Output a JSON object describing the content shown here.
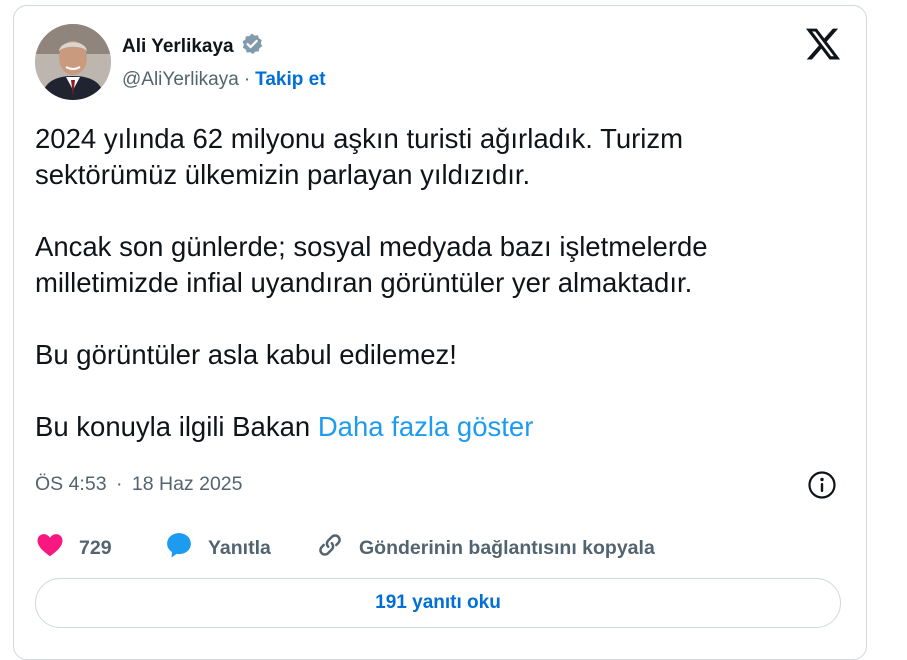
{
  "author": {
    "name": "Ali Yerlikaya",
    "handle": "@AliYerlikaya",
    "separator": "·",
    "follow_label": "Takip et",
    "verified_icon": "verified-badge-icon",
    "avatar": "profile-photo"
  },
  "platform_icon": "x-logo-icon",
  "tweet": {
    "text": "2024 yılında 62 milyonu aşkın turisti ağırladık. Turizm\nsektörümüz ülkemizin parlayan yıldızıdır.\n\nAncak son günlerde; sosyal medyada bazı işletmelerde\nmilletimizde infial uyandıran görüntüler yer almaktadır.\n\nBu görüntüler asla kabul edilemez!\n\nBu konuyla ilgili Bakan ",
    "show_more": "Daha fazla göster"
  },
  "meta": {
    "time": "ÖS 4:53",
    "separator": "·",
    "date": "18 Haz 2025",
    "info_icon": "info-icon"
  },
  "actions": {
    "likes": {
      "icon": "heart-icon",
      "count": "729",
      "color": "#f91880"
    },
    "reply": {
      "icon": "reply-bubble-icon",
      "label": "Yanıtla",
      "color": "#1d9bf0"
    },
    "copy": {
      "icon": "link-icon",
      "label": "Gönderinin bağlantısını kopyala"
    }
  },
  "replies_button": {
    "label": "191 yanıtı oku"
  },
  "colors": {
    "accent": "#1d9bf0",
    "link": "#006fd6",
    "muted": "#536471",
    "text": "#0f1419",
    "border": "#cfd9de"
  }
}
